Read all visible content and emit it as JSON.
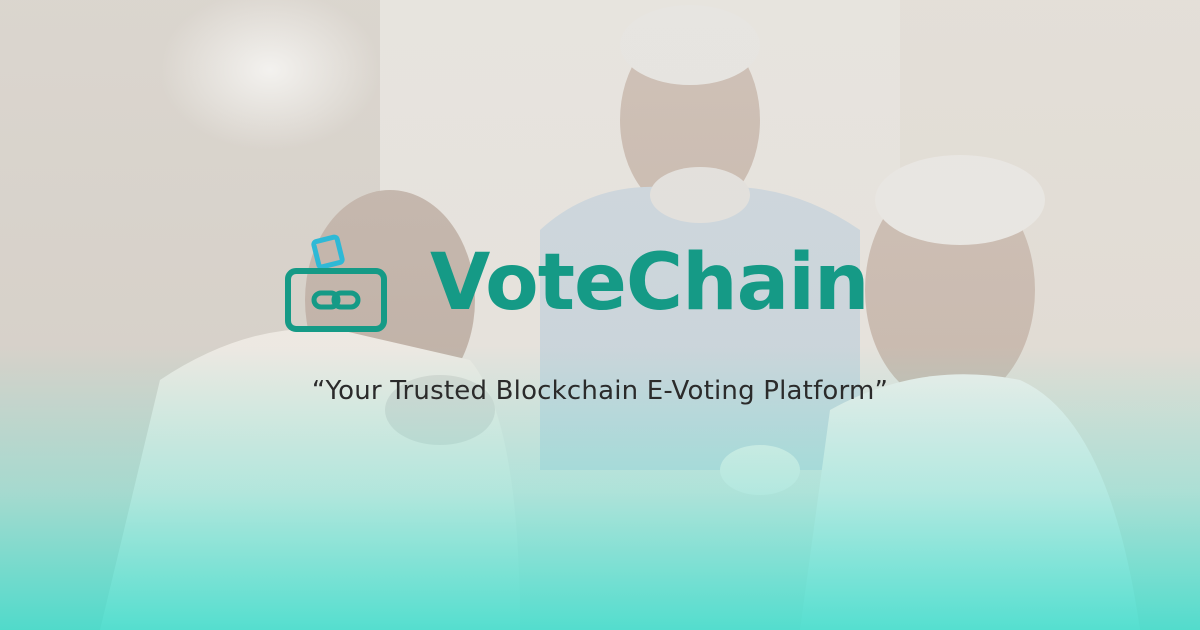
{
  "brand": {
    "name": "VoteChain",
    "logo_icon": "ballot-box-chain-icon",
    "color": "#159a86",
    "accent_color": "#2eb9d6"
  },
  "tagline": "“Your Trusted Blockchain E-Voting Platform”",
  "background": {
    "photo": "three-elderly-men-looking-at-phone",
    "gradient_bottom_color": "#48dece"
  }
}
